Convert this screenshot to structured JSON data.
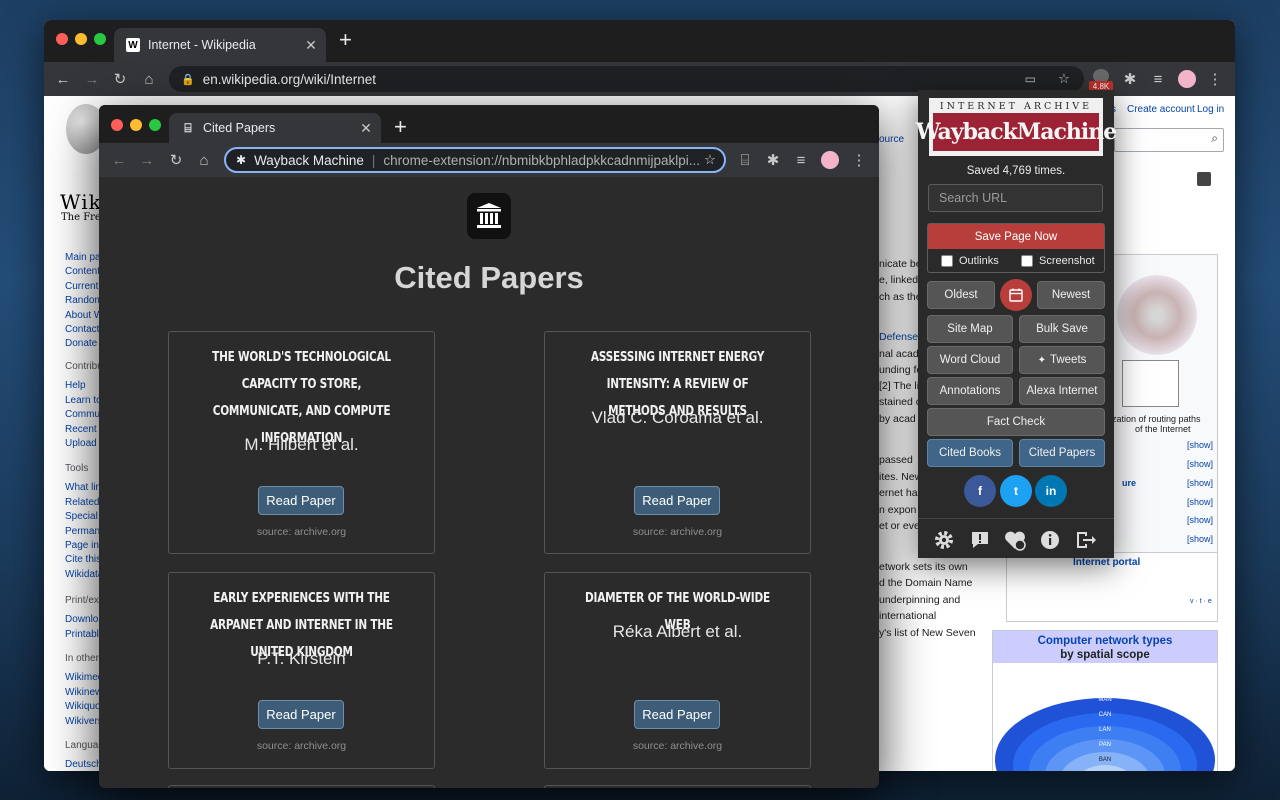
{
  "back_window": {
    "tab_title": "Internet - Wikipedia",
    "tab_favicon": "W",
    "url": "en.wikipedia.org/wiki/Internet",
    "extension_badge": "4.8K",
    "wiki": {
      "header_links": [
        "s",
        "Create account",
        "Log in"
      ],
      "source_fragment": "ource",
      "logo_fragment": "Wik",
      "tagline_fragment": "The Free",
      "sidebar": [
        "Main pa",
        "Content",
        "Current",
        "Random",
        "About W",
        "Contact",
        "Donate"
      ],
      "contribute_heading": "Contribu",
      "contribute": [
        "Help",
        "Learn to",
        "Commu",
        "Recent c",
        "Upload f"
      ],
      "tools_heading": "Tools",
      "tools": [
        "What lin",
        "Related",
        "Special",
        "Permane",
        "Page inf",
        "Cite this",
        "Wikidata"
      ],
      "print_heading": "Print/exp",
      "print": [
        "Downlo",
        "Printabl"
      ],
      "other_heading": "In other",
      "other": [
        "Wikimed",
        "Wikinew",
        "Wikiquo",
        "Wikivers"
      ],
      "lang_heading": "Languag",
      "lang": [
        "Deutsch"
      ],
      "body_fragments": [
        "nicate be",
        "e, linked",
        "ch as the",
        "Defense",
        "nal acad",
        "unding fo",
        "[2] The li",
        "stained c",
        "by acad",
        "passed",
        "ites. New",
        "ernet ha",
        "n expon",
        "et or eve",
        "etwork sets its own",
        "d the Domain Name",
        "underpinning and",
        "international",
        "y's list of New Seven"
      ],
      "infobox_caption_1": "zation of routing paths",
      "infobox_caption_2": "of the Internet",
      "show_label": "[show]",
      "ture_fragment": "ure",
      "internet_portal": "Internet portal",
      "vte": "v · t · e",
      "network_box_title_1": "Computer network types",
      "network_box_title_2": "by spatial scope",
      "rings": [
        "WAN",
        "RAN",
        "MAN",
        "CAN",
        "LAN",
        "PAN",
        "BAN"
      ]
    }
  },
  "front_window": {
    "tab_title": "Cited Papers",
    "omnibox_label": "Wayback Machine",
    "url": "chrome-extension://nbmibkbphladpkkcadnmijpaklpi...",
    "page_title": "Cited Papers",
    "read_label": "Read Paper",
    "source_label": "source: archive.org",
    "papers": [
      {
        "title": "THE WORLD'S TECHNOLOGICAL CAPACITY TO STORE, COMMUNICATE, AND COMPUTE INFORMATION",
        "author": "M. Hilbert et al."
      },
      {
        "title": "ASSESSING INTERNET ENERGY INTENSITY: A REVIEW OF METHODS AND RESULTS",
        "author": "Vlad C. Coroama et al."
      },
      {
        "title": "EARLY EXPERIENCES WITH THE ARPANET AND INTERNET IN THE UNITED KINGDOM",
        "author": "P.T. Kirstein"
      },
      {
        "title": "DIAMETER OF THE WORLD-WIDE WEB",
        "author": "Réka Albert et al."
      }
    ]
  },
  "popup": {
    "logo_top": "INTERNET ARCHIVE",
    "logo_main": "WaybackMachine",
    "saved": "Saved 4,769 times.",
    "search_placeholder": "Search URL",
    "save_now": "Save Page Now",
    "outlinks": "Outlinks",
    "screenshot": "Screenshot",
    "oldest": "Oldest",
    "newest": "Newest",
    "site_map": "Site Map",
    "bulk_save": "Bulk Save",
    "word_cloud": "Word Cloud",
    "tweets": "Tweets",
    "annotations": "Annotations",
    "alexa": "Alexa Internet",
    "fact_check": "Fact Check",
    "cited_books": "Cited Books",
    "cited_papers": "Cited Papers",
    "social": [
      "f",
      "t",
      "in"
    ],
    "colors": {
      "red": "#b83e3b",
      "facebook": "#3b5998",
      "twitter": "#1da1f2",
      "linkedin": "#0077b5"
    }
  }
}
